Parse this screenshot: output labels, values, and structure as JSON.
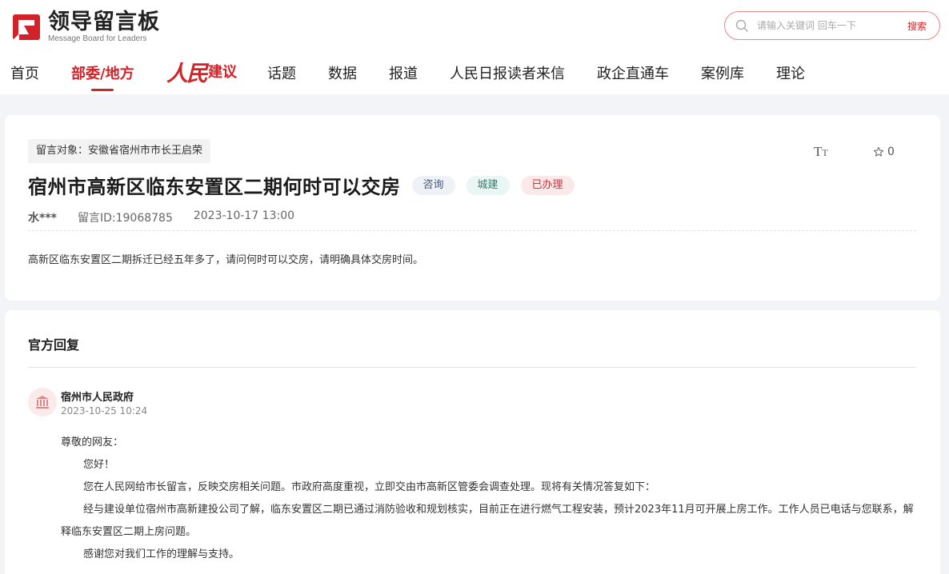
{
  "header": {
    "logo_title": "领导留言板",
    "logo_subtitle": "Message Board for Leaders",
    "search_placeholder": "请输入关键词 回车一下",
    "search_button": "搜索"
  },
  "nav": {
    "items": [
      "首页",
      "部委/地方",
      "话题",
      "数据",
      "报道",
      "人民日报读者来信",
      "政企直通车",
      "案例库",
      "理论"
    ],
    "active_index": 1,
    "brand_script": "人民",
    "brand_label": "建议"
  },
  "message": {
    "target": "留言对象：安徽省宿州市市长王启荣",
    "title": "宿州市高新区临东安置区二期何时可以交房",
    "tags": [
      "咨询",
      "城建",
      "已办理"
    ],
    "author": "水***",
    "message_id": "留言ID:19068785",
    "datetime": "2023-10-17 13:00",
    "content": "高新区临东安置区二期拆迁已经五年多了，请问何时可以交房，请明确具体交房时间。",
    "font_size_label": "Tт",
    "favorite_count": "0"
  },
  "reply": {
    "heading": "官方回复",
    "org": "宿州市人民政府",
    "datetime": "2023-10-25 10:24",
    "salutation": "尊敬的网友：",
    "paragraphs": [
      "您好！",
      "您在人民网给市长留言，反映交房相关问题。市政府高度重视，立即交由市高新区管委会调查处理。现将有关情况答复如下：",
      "经与建设单位宿州市高新建投公司了解，临东安置区二期已通过消防验收和规划核实，目前正在进行燃气工程安装，预计2023年11月可开展上房工作。工作人员已电话与您联系，解释临东安置区二期上房问题。",
      "感谢您对我们工作的理解与支持。"
    ]
  },
  "colors": {
    "brand_red": "#d2232a",
    "page_bg": "#f3f4f7"
  },
  "icons": {
    "logo": "leaders-logo-icon",
    "search": "search-icon",
    "font_size": "font-size-icon",
    "favorite": "star-icon",
    "gov": "government-building-icon"
  }
}
